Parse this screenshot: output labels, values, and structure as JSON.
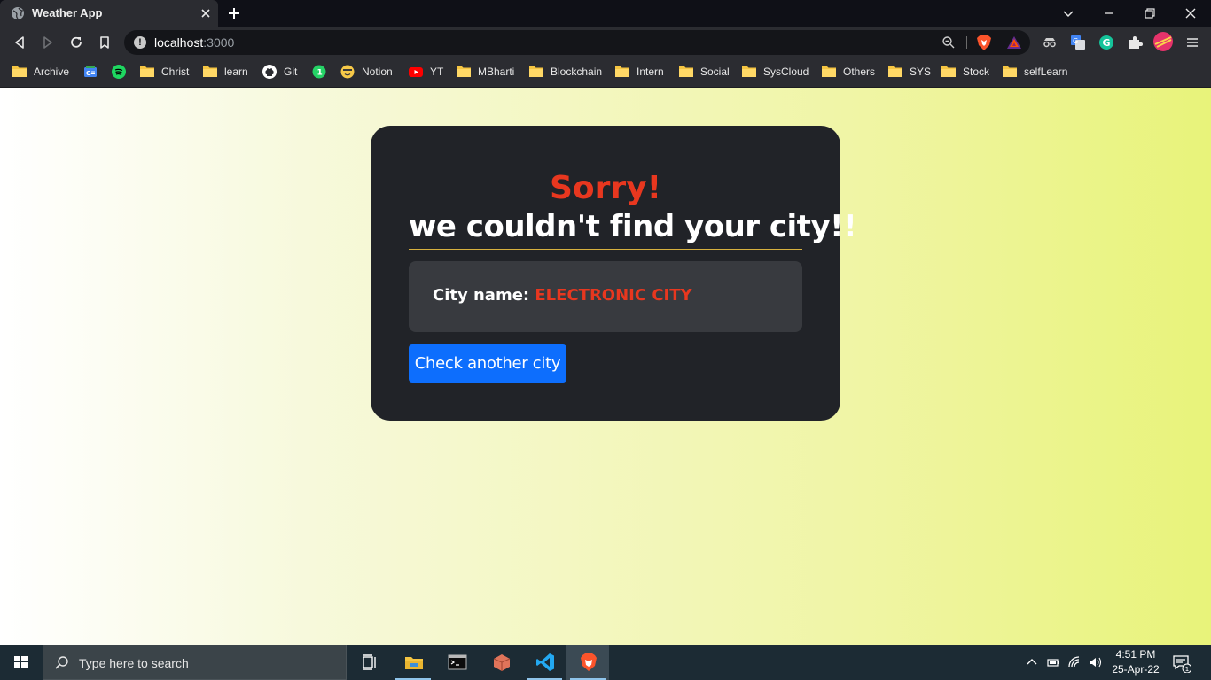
{
  "browser": {
    "tab_title": "Weather App",
    "url_host": "localhost",
    "url_port": ":3000",
    "bookmarks": [
      {
        "label": "Archive",
        "icon": "folder-icon"
      },
      {
        "label": "",
        "icon": "google-news-icon"
      },
      {
        "label": "",
        "icon": "spotify-icon"
      },
      {
        "label": "Christ",
        "icon": "folder-icon"
      },
      {
        "label": "learn",
        "icon": "folder-icon"
      },
      {
        "label": "Git",
        "icon": "github-icon"
      },
      {
        "label": "",
        "icon": "whatsapp-icon"
      },
      {
        "label": "Notion",
        "icon": "notion-emoji-icon"
      },
      {
        "label": "YT",
        "icon": "youtube-icon"
      },
      {
        "label": "MBharti",
        "icon": "folder-icon"
      },
      {
        "label": "Blockchain",
        "icon": "folder-icon"
      },
      {
        "label": "Intern",
        "icon": "folder-icon"
      },
      {
        "label": "Social",
        "icon": "folder-icon"
      },
      {
        "label": "SysCloud",
        "icon": "folder-icon"
      },
      {
        "label": "Others",
        "icon": "folder-icon"
      },
      {
        "label": "SYS",
        "icon": "folder-icon"
      },
      {
        "label": "Stock",
        "icon": "folder-icon"
      },
      {
        "label": "selfLearn",
        "icon": "folder-icon"
      }
    ]
  },
  "page": {
    "heading": "Sorry!",
    "subheading": "we couldn't find your city!!",
    "city_label": "City name:",
    "city_value": "ELECTRONIC CITY",
    "check_button": "Check another city"
  },
  "taskbar": {
    "search_placeholder": "Type here to search",
    "time": "4:51 PM",
    "date": "25-Apr-22",
    "notification_count": "1"
  },
  "colors": {
    "error_red": "#e8371f",
    "button_blue": "#0d6efd",
    "card_bg": "#212328",
    "underline_gold": "#d7b13f"
  }
}
